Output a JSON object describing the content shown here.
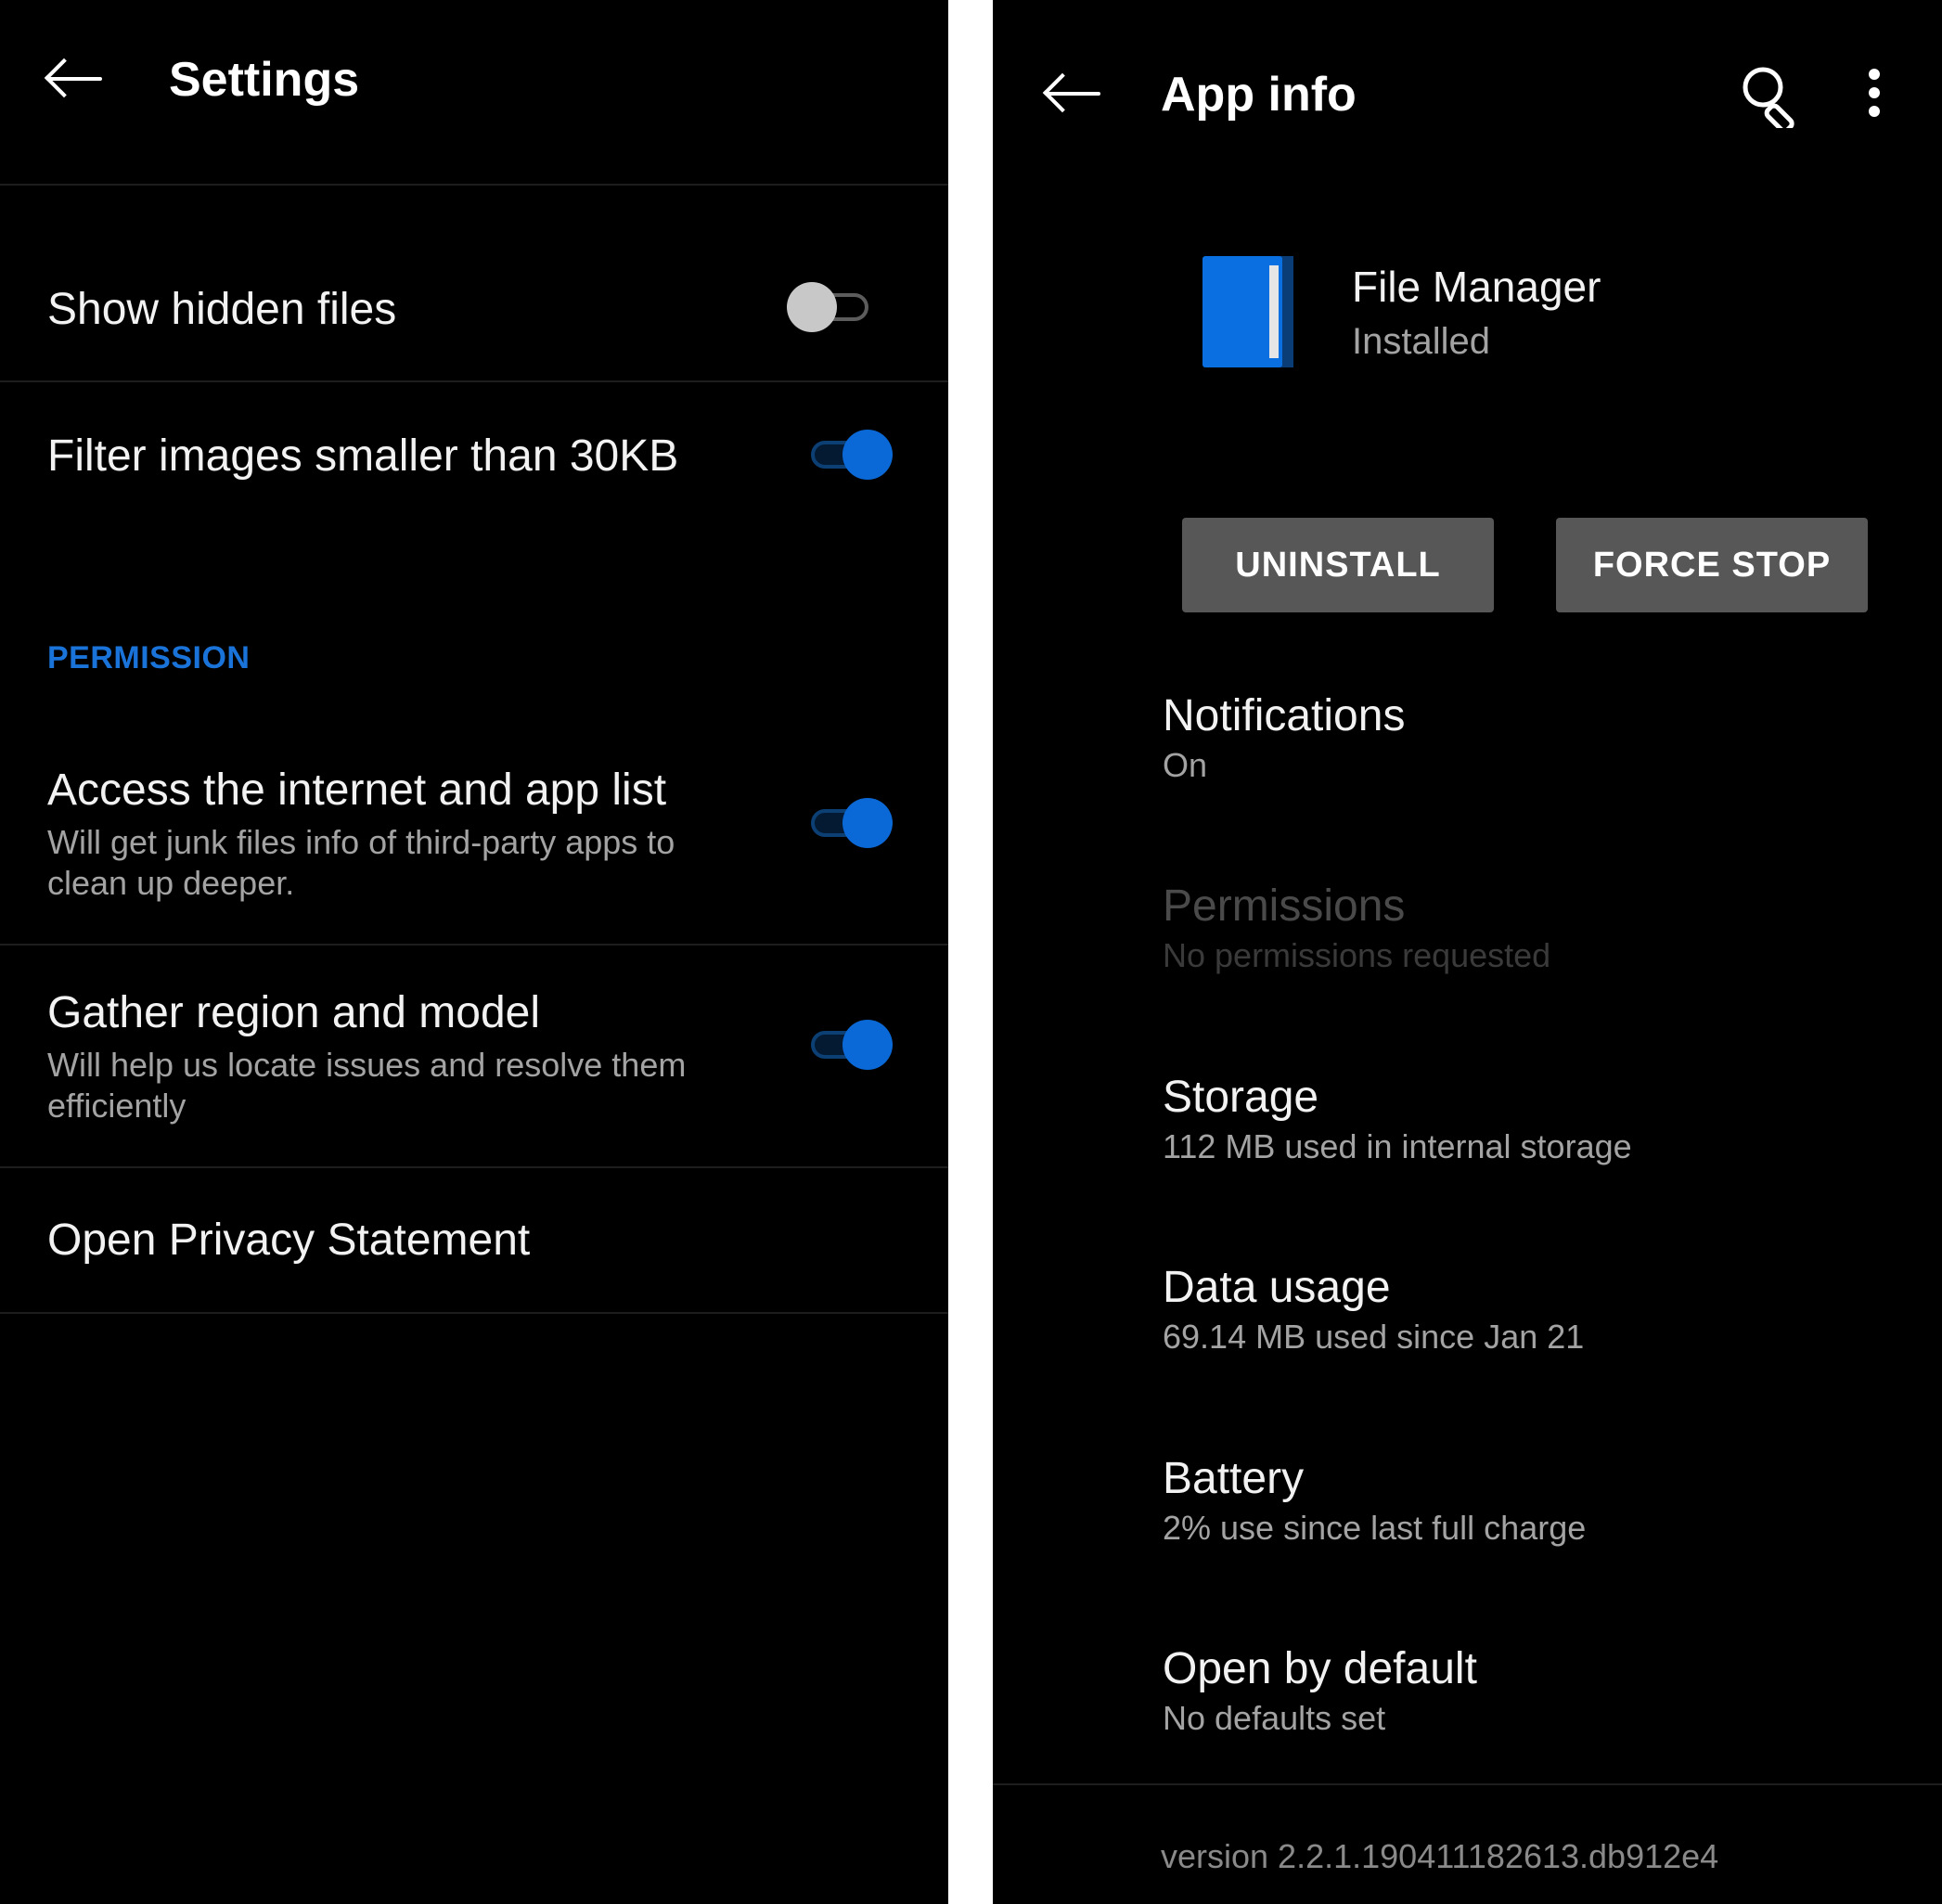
{
  "settings": {
    "title": "Settings",
    "rows": {
      "show_hidden": {
        "label": "Show hidden files",
        "enabled": false
      },
      "filter_images": {
        "label": "Filter images smaller than 30KB",
        "enabled": true
      },
      "access_internet": {
        "label": "Access the internet and app list",
        "desc_line1": "Will get junk files info of third-party apps to",
        "desc_line2": "clean up deeper.",
        "enabled": true
      },
      "gather_region": {
        "label": "Gather region and model",
        "desc_line1": "Will help us locate issues and resolve them",
        "desc_line2": "efficiently",
        "enabled": true
      },
      "privacy": {
        "label": "Open Privacy Statement"
      }
    },
    "section_permission": "PERMISSION"
  },
  "app_info": {
    "title": "App info",
    "app_name": "File Manager",
    "app_status": "Installed",
    "buttons": {
      "uninstall": "UNINSTALL",
      "force_stop": "FORCE STOP"
    },
    "items": {
      "notifications": {
        "title": "Notifications",
        "sub": "On"
      },
      "permissions": {
        "title": "Permissions",
        "sub": "No permissions requested"
      },
      "storage": {
        "title": "Storage",
        "sub": "112 MB used in internal storage"
      },
      "data_usage": {
        "title": "Data usage",
        "sub": "69.14 MB used since Jan 21"
      },
      "battery": {
        "title": "Battery",
        "sub": "2% use since last full charge"
      },
      "open_default": {
        "title": "Open by default",
        "sub": "No defaults set"
      }
    },
    "version": "version 2.2.1.190411182613.db912e4"
  },
  "colors": {
    "accent": "#0a69d6",
    "section_header": "#1a73d9",
    "button_bg": "#575757"
  },
  "icons": {
    "back": "back-arrow-icon",
    "search": "search-icon",
    "more": "more-vert-icon",
    "app": "file-manager-app-icon"
  }
}
